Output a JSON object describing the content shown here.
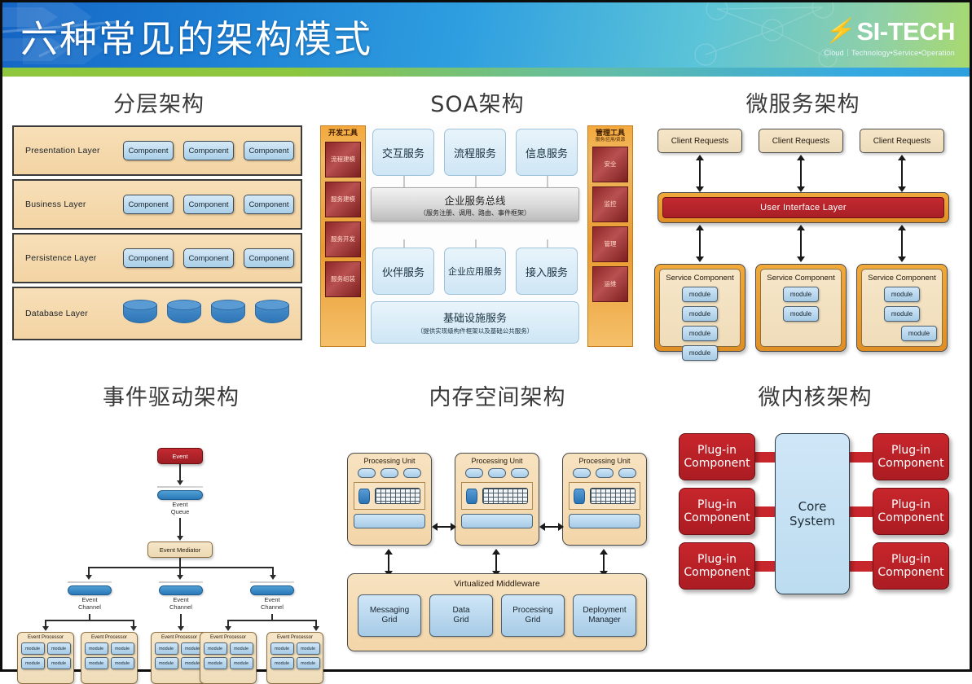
{
  "header": {
    "title": "六种常见的架构模式",
    "logo_name": "SI-TECH",
    "logo_bolt": "⚡",
    "logo_tagline": "Cloud｜Technology•Service•Operation"
  },
  "panels": {
    "layered": {
      "title": "分层架构",
      "layers": [
        {
          "label": "Presentation Layer",
          "components": [
            "Component",
            "Component",
            "Component"
          ]
        },
        {
          "label": "Business Layer",
          "components": [
            "Component",
            "Component",
            "Component"
          ]
        },
        {
          "label": "Persistence Layer",
          "components": [
            "Component",
            "Component",
            "Component"
          ]
        },
        {
          "label": "Database Layer",
          "components": []
        }
      ],
      "database_count": 4
    },
    "soa": {
      "title": "SOA架构",
      "left_column": {
        "header": "开发工具",
        "items": [
          "流程建模",
          "服务建模",
          "服务开发",
          "服务组装"
        ]
      },
      "right_column": {
        "header": "管理工具",
        "subheader": "服务/应用/资源",
        "items": [
          "安全",
          "监控",
          "管理",
          "运维"
        ]
      },
      "top_services": [
        "交互服务",
        "流程服务",
        "信息服务"
      ],
      "bus": {
        "title": "企业服务总线",
        "subtitle": "（服务注册、调用、路由、事件框架）"
      },
      "mid_services": [
        "伙伴服务",
        "企业应用服务",
        "接入服务"
      ],
      "bottom": {
        "title": "基础设施服务",
        "subtitle": "（提供实现级构件框架以及基础公共服务）"
      }
    },
    "microservices": {
      "title": "微服务架构",
      "client_requests": [
        "Client Requests",
        "Client Requests",
        "Client Requests"
      ],
      "ui_layer": "User Interface Layer",
      "service_components": [
        {
          "label": "Service Component",
          "modules": [
            "module",
            "module",
            "module",
            "module"
          ]
        },
        {
          "label": "Service Component",
          "modules": [
            "module",
            "module"
          ]
        },
        {
          "label": "Service Component",
          "modules": [
            "module",
            "module",
            "module"
          ]
        }
      ]
    },
    "event_driven": {
      "title": "事件驱动架构",
      "event": "Event",
      "event_queue": "Event\nQueue",
      "event_queue_line1": "Event",
      "event_queue_line2": "Queue",
      "event_mediator": "Event Mediator",
      "channels": [
        "Event Channel",
        "Event Channel",
        "Event Channel"
      ],
      "channel_line1": "Event",
      "channel_line2": "Channel",
      "processors": [
        {
          "label": "Event Processor",
          "modules": [
            "module",
            "module",
            "module",
            "module"
          ]
        },
        {
          "label": "Event Processor",
          "modules": [
            "module",
            "module",
            "module",
            "module"
          ]
        },
        {
          "label": "Event Processor",
          "modules": [
            "module",
            "module",
            "module",
            "module"
          ]
        },
        {
          "label": "Event Processor",
          "modules": [
            "module",
            "module",
            "module",
            "module"
          ]
        },
        {
          "label": "Event Processor",
          "modules": [
            "module",
            "module",
            "module",
            "module"
          ]
        }
      ]
    },
    "memory_space": {
      "title": "内存空间架构",
      "processing_units": [
        "Processing Unit",
        "Processing Unit",
        "Processing Unit"
      ],
      "middleware_title": "Virtualized Middleware",
      "grids": [
        {
          "line1": "Messaging",
          "line2": "Grid"
        },
        {
          "line1": "Data",
          "line2": "Grid"
        },
        {
          "line1": "Processing",
          "line2": "Grid"
        },
        {
          "line1": "Deployment",
          "line2": "Manager"
        }
      ]
    },
    "microkernel": {
      "title": "微内核架构",
      "core": {
        "line1": "Core",
        "line2": "System"
      },
      "plugins": [
        {
          "line1": "Plug-in",
          "line2": "Component"
        },
        {
          "line1": "Plug-in",
          "line2": "Component"
        },
        {
          "line1": "Plug-in",
          "line2": "Component"
        },
        {
          "line1": "Plug-in",
          "line2": "Component"
        },
        {
          "line1": "Plug-in",
          "line2": "Component"
        },
        {
          "line1": "Plug-in",
          "line2": "Component"
        }
      ]
    }
  },
  "colors": {
    "header_blue": "#1d7fd4",
    "header_green": "#8dc63f",
    "accent_red": "#c32a30",
    "accent_orange": "#e08f24",
    "tan": "#f3d6a9",
    "light_blue": "#a7cbe6"
  }
}
